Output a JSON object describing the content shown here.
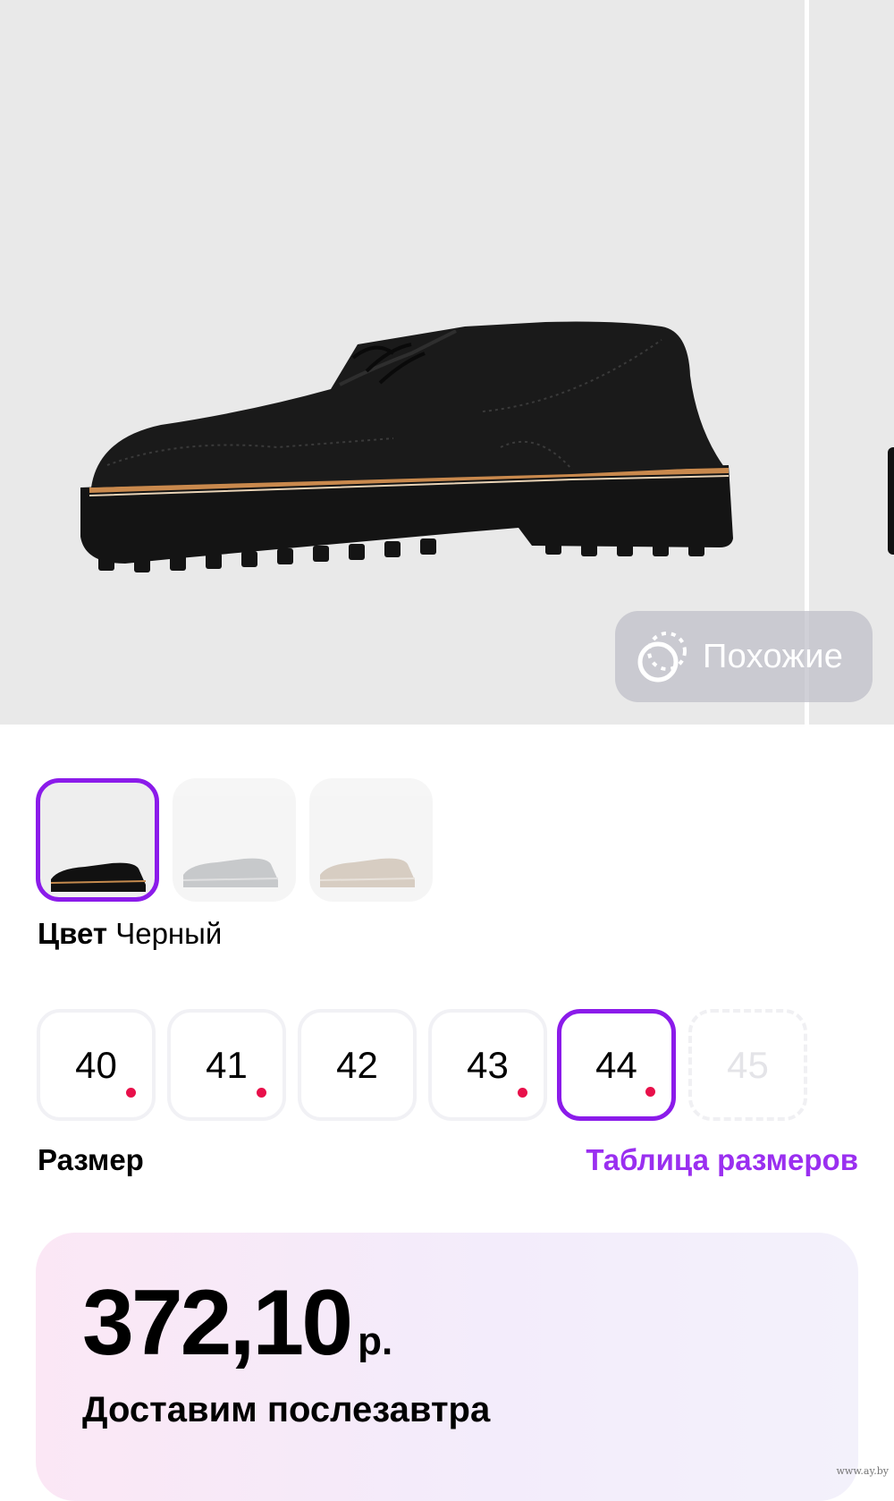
{
  "gallery": {
    "similar_button_label": "Похожие"
  },
  "color": {
    "label": "Цвет",
    "value": "Черный",
    "swatches": [
      {
        "name": "black",
        "selected": true
      },
      {
        "name": "grey",
        "selected": false
      },
      {
        "name": "beige",
        "selected": false
      }
    ]
  },
  "sizes": {
    "label": "Размер",
    "table_link": "Таблица размеров",
    "items": [
      {
        "label": "40",
        "low_stock": true,
        "available": true
      },
      {
        "label": "41",
        "low_stock": true,
        "available": true
      },
      {
        "label": "42",
        "low_stock": false,
        "available": true
      },
      {
        "label": "43",
        "low_stock": true,
        "available": true
      },
      {
        "label": "44",
        "low_stock": true,
        "available": true,
        "selected": true
      },
      {
        "label": "45",
        "low_stock": false,
        "available": false
      }
    ]
  },
  "price": {
    "amount": "372,10",
    "currency": "р.",
    "delivery": "Доставим послезавтра"
  },
  "watermark": "www.ay.by",
  "colors": {
    "accent": "#8b1bea",
    "link": "#9a2ff0",
    "low_stock_dot": "#e8104a"
  }
}
